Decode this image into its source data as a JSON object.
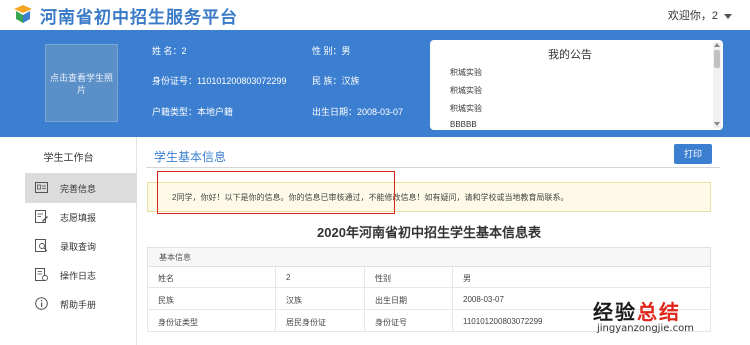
{
  "header": {
    "site_title": "河南省初中招生服务平台",
    "welcome": "欢迎你，2"
  },
  "student": {
    "photo_hint": "点击查看学生照片",
    "name_label": "姓  名：",
    "name_value": "2",
    "id_label": "身份证号：",
    "id_value": "110101200803072299",
    "hukou_label": "户籍类型：",
    "hukou_value": "本地户籍",
    "gender_label": "性  别：",
    "gender_value": "男",
    "ethnicity_label": "民  族：",
    "ethnicity_value": "汉族",
    "birth_label": "出生日期：",
    "birth_value": "2008-03-07"
  },
  "notices": {
    "title": "我的公告",
    "items": [
      "积城实验",
      "积城实验",
      "积城实验",
      "BBBBB"
    ]
  },
  "sidebar": {
    "title": "学生工作台",
    "items": [
      {
        "label": "完善信息",
        "icon": "id-card-icon"
      },
      {
        "label": "志愿填报",
        "icon": "edit-form-icon"
      },
      {
        "label": "录取查询",
        "icon": "search-doc-icon"
      },
      {
        "label": "操作日志",
        "icon": "log-icon"
      },
      {
        "label": "帮助手册",
        "icon": "info-icon"
      }
    ]
  },
  "main": {
    "title": "学生基本信息",
    "print_label": "打印",
    "alert": "2同学，你好！以下是你的信息。你的信息已审核通过，不能修改信息！如有疑问，请和学校或当地教育局联系。",
    "form_title": "2020年河南省初中招生学生基本信息表",
    "section_label": "基本信息",
    "rows": [
      [
        "姓名",
        "2",
        "性别",
        "男"
      ],
      [
        "民族",
        "汉族",
        "出生日期",
        "2008-03-07"
      ],
      [
        "身份证类型",
        "居民身份证",
        "身份证号",
        "110101200803072299"
      ]
    ]
  },
  "watermark": {
    "text_a": "经验",
    "text_b": "总结",
    "url": "jingyanzongjie.com"
  },
  "colors": {
    "brand_blue": "#3c7fd0",
    "highlight_red": "#e0261c"
  }
}
